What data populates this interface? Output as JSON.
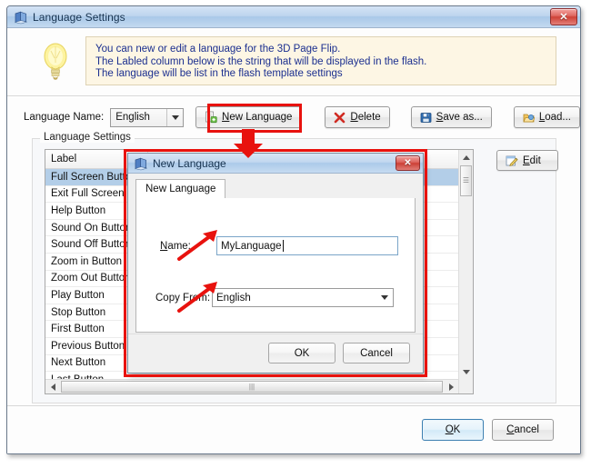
{
  "window": {
    "title": "Language Settings",
    "icon": "book-icon",
    "close_label": "✕"
  },
  "info": {
    "icon": "lightbulb-icon",
    "lines": [
      "You can new or edit  a language for the 3D Page Flip.",
      "The Labled column below is the string that will be displayed in the flash.",
      "The language will be list in the flash template settings"
    ]
  },
  "toolbar": {
    "language_name_label": "Language Name:",
    "language_name_value": "English",
    "buttons": [
      {
        "id": "new-language",
        "label": "New Language",
        "underline": "N",
        "icon": "add-page-icon"
      },
      {
        "id": "delete",
        "label": "Delete",
        "underline": "D",
        "icon": "red-x-icon"
      },
      {
        "id": "save-as",
        "label": "Save as...",
        "underline": "S",
        "icon": "floppy-disk-icon"
      },
      {
        "id": "load",
        "label": "Load...",
        "underline": "L",
        "icon": "open-folder-icon"
      }
    ]
  },
  "group": {
    "title": "Language Settings"
  },
  "list": {
    "columns": [
      "Label",
      ""
    ],
    "rows": [
      "Full Screen Button",
      "Exit Full Screen Button",
      "Help Button",
      "Sound On Button",
      "Sound Off Button",
      "Zoom in Button",
      "Zoom Out Button",
      "Play Button",
      "Stop Button",
      "First Button",
      "Previous Button",
      "Next Button",
      "Last Button"
    ],
    "selected_index": 0
  },
  "side": {
    "edit_label": "Edit",
    "edit_underline": "E",
    "edit_icon": "pencil-edit-icon"
  },
  "footer": {
    "ok_label": "OK",
    "ok_underline": "O",
    "cancel_label": "Cancel",
    "cancel_underline": "C"
  },
  "dialog": {
    "title": "New Language",
    "icon": "book-icon",
    "close_label": "✕",
    "tab_label": "New Language",
    "name_label": "Name:",
    "name_underline": "N",
    "name_value": "MyLanguage",
    "copy_from_label": "Copy From:",
    "copy_from_value": "English",
    "ok_label": "OK",
    "cancel_label": "Cancel"
  },
  "annotations": {
    "highlight_color": "#e8120e",
    "items": [
      {
        "name": "new-language-highlight",
        "shape": "rectangle"
      },
      {
        "name": "dialog-highlight",
        "shape": "rectangle"
      },
      {
        "name": "down-arrow-to-dialog",
        "shape": "arrow"
      },
      {
        "name": "arrow-to-name-field",
        "shape": "arrow"
      },
      {
        "name": "arrow-to-copy-from-field",
        "shape": "arrow"
      }
    ]
  }
}
